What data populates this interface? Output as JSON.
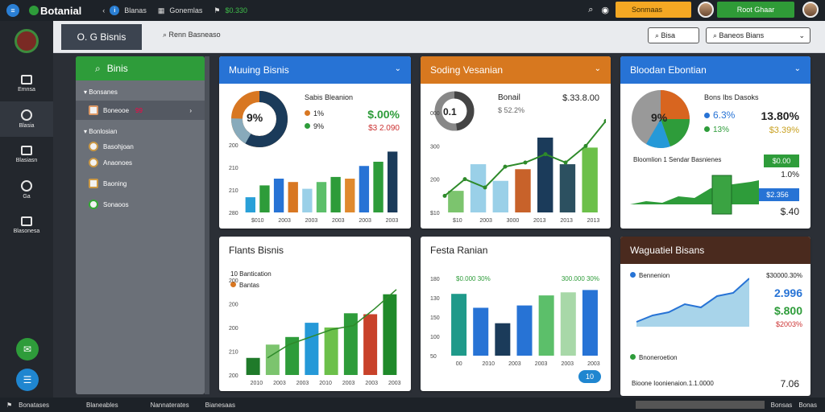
{
  "topbar": {
    "brand": "Botanial",
    "nav": [
      "Blanas",
      "Gonemlas",
      "$0.330"
    ],
    "yellow_btn": "Sonmaas",
    "green_btn": "Root Ghaar"
  },
  "leftbar": {
    "items": [
      "Emnsa",
      "Blasia",
      "Blasiasn",
      "Ga",
      "Blasonesa"
    ]
  },
  "header2": {
    "tab": "O. G Bisnis",
    "search": "Renn Basneaso",
    "btn1": "Bisa",
    "btn2": "Baneos Bians"
  },
  "filter": {
    "title": "Binis",
    "section1": "Bonsanes",
    "row_selected": "Boneooe",
    "row_selected_value": "99",
    "section2": "Bonlosian",
    "rows": [
      "Basohjoan",
      "Anaonoes",
      "Baoning",
      "Sonaoos"
    ]
  },
  "card1": {
    "title": "Muuing Bisnis",
    "donut_label": "9%",
    "subtitle": "Sabis Bleanion",
    "leg1": "1%",
    "leg2": "9%",
    "val1": "$.00%",
    "val2": "$3 2.090",
    "ylabels": [
      "200",
      "210",
      "210",
      "280"
    ],
    "xlabels": [
      "$010",
      "2003",
      "2003",
      "2003",
      "2003",
      "2003"
    ]
  },
  "card2": {
    "title": "Soding Vesanian",
    "donut_label": "0.1",
    "subtitle": "Bonail",
    "sub2": "$ 52.2%",
    "val1": "$.33.8.00",
    "ylabels": [
      "000",
      "300",
      "200",
      "$10"
    ],
    "xlabels": [
      "$10",
      "2003",
      "3000",
      "2013",
      "2013",
      "2013"
    ]
  },
  "card3": {
    "title": "Bloodan Ebontian",
    "donut_label": "9%",
    "subtitle": "Bons Ibs Dasoks",
    "leg1": "6.3%",
    "leg2": "13%",
    "val1": "13.80%",
    "val2": "$3.39%",
    "line2": "Bloomlion 1 Sendar Basnienes",
    "badge1": "$0.00",
    "val3": "1.0%",
    "badge2": "$2.356",
    "val4": "$.40"
  },
  "card4": {
    "title": "Flants Bisnis",
    "sub1": "10 Bantication",
    "sub2": "Bantas",
    "ylabels": [
      "200",
      "200",
      "200",
      "210",
      "200"
    ],
    "xlabels": [
      "2010",
      "2003",
      "2003",
      "2010",
      "2003",
      "2003",
      "2003"
    ]
  },
  "card5": {
    "title": "Festa Ranian",
    "label1": "$0.000 30%",
    "label2": "300.000 30%",
    "ylabels": [
      "180",
      "130",
      "150",
      "100",
      "50"
    ],
    "xlabels": [
      "00",
      "2010",
      "2003",
      "2003",
      "2003",
      "2003"
    ],
    "badge": "10"
  },
  "card6": {
    "title": "Waguatiel Bisans",
    "leg1": "Bennenion",
    "val1": "$30000.30%",
    "val2": "2.996",
    "val3": "$.800",
    "val4": "$2003%",
    "leg2": "Bnoneroetion",
    "foot": "Bioone Ioonienaion.1.1.0000",
    "foot_val": "7.06"
  },
  "bottombar": [
    "Bonatases",
    "Blaneables",
    "Nannaterates",
    "Bianesaas",
    "Bonsas",
    "Bonas"
  ],
  "chart_data": [
    {
      "type": "bar",
      "title": "Muuing Bisnis",
      "values": [
        18,
        32,
        40,
        36,
        28,
        36,
        42,
        40,
        55,
        60,
        72
      ]
    },
    {
      "type": "bar",
      "title": "Soding Vesanian",
      "values": [
        26,
        58,
        38,
        52,
        90,
        58,
        78
      ],
      "line": [
        20,
        40,
        30,
        55,
        60,
        70,
        60,
        80,
        110
      ]
    },
    {
      "type": "bar",
      "title": "Flants Bisnis",
      "values": [
        18,
        32,
        40,
        55,
        50,
        65,
        64,
        85
      ]
    },
    {
      "type": "bar",
      "title": "Festa Ranian",
      "values": [
        80,
        62,
        42,
        65,
        78,
        82,
        85
      ]
    }
  ],
  "colors": {
    "green": "#2e9c3a",
    "blue": "#2277d0",
    "orange": "#d87722",
    "dark": "#4a2a1e"
  }
}
